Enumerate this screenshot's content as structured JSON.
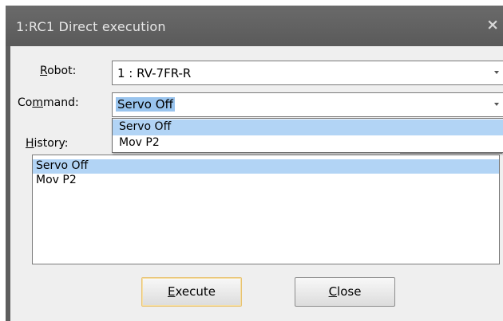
{
  "window": {
    "title": "1:RC1  Direct execution",
    "close_glyph": "×"
  },
  "form": {
    "robot_label": {
      "key": "R",
      "rest": "obot:"
    },
    "robot_value": "1 : RV-7FR-R",
    "command_label": {
      "pre": "Co",
      "key": "m",
      "rest": "mand:"
    },
    "command_value": "Servo Off",
    "history_label": {
      "key": "H",
      "rest": "istory:"
    }
  },
  "dropdown": {
    "options": [
      "Servo Off",
      "Mov P2"
    ],
    "highlighted": "Servo Off"
  },
  "history": {
    "items": [
      "Servo Off",
      "Mov P2"
    ],
    "selected": "Servo Off"
  },
  "buttons": {
    "execute": {
      "key": "E",
      "rest": "xecute"
    },
    "close": {
      "key": "C",
      "rest": "lose"
    }
  },
  "icons": {
    "combo_arrow": "chevron-down-icon",
    "close": "close-icon"
  }
}
